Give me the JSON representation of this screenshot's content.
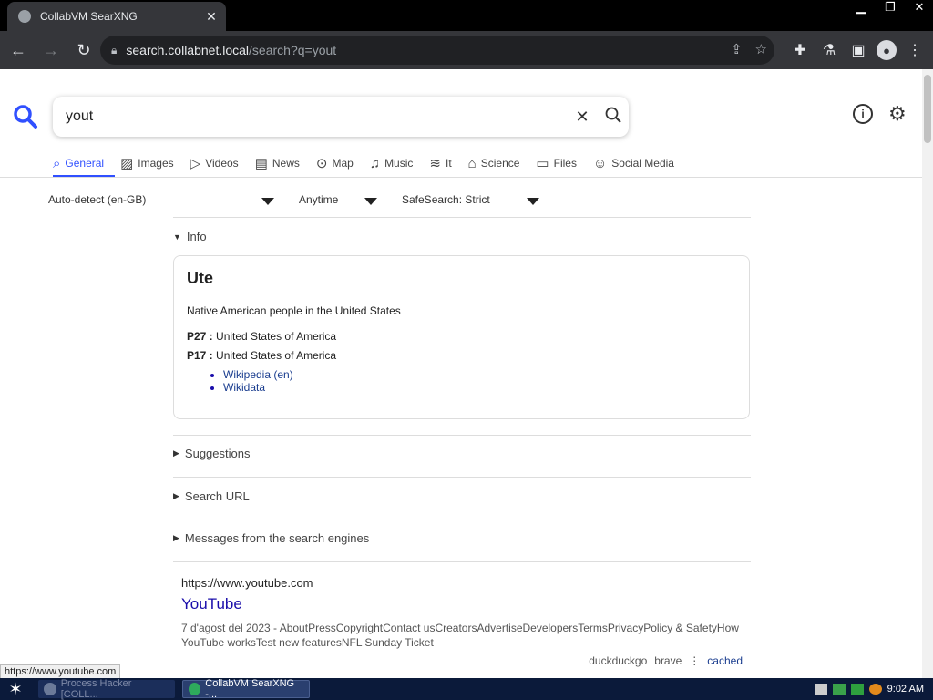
{
  "browser": {
    "tab_title": "CollabVM SearXNG",
    "tab_close": "✕",
    "url_host": "search.collabnet.local",
    "url_path": "/search?q=yout"
  },
  "search": {
    "query": "yout",
    "categories": [
      {
        "label": "General",
        "icon": "search-icon"
      },
      {
        "label": "Images",
        "icon": "image-icon"
      },
      {
        "label": "Videos",
        "icon": "play-icon"
      },
      {
        "label": "News",
        "icon": "newspaper-icon"
      },
      {
        "label": "Map",
        "icon": "map-pin-icon"
      },
      {
        "label": "Music",
        "icon": "music-icon"
      },
      {
        "label": "It",
        "icon": "layers-icon"
      },
      {
        "label": "Science",
        "icon": "graduation-icon"
      },
      {
        "label": "Files",
        "icon": "archive-icon"
      },
      {
        "label": "Social Media",
        "icon": "people-icon"
      }
    ],
    "filters": {
      "language": "Auto-detect (en-GB)",
      "time": "Anytime",
      "safesearch": "SafeSearch: Strict"
    }
  },
  "sections": {
    "info": "Info",
    "suggestions": "Suggestions",
    "search_url": "Search URL",
    "messages": "Messages from the search engines"
  },
  "infobox": {
    "title": "Ute",
    "description": "Native American people in the United States",
    "props": [
      {
        "key": "P27 :",
        "value": "United States of America"
      },
      {
        "key": "P17 :",
        "value": "United States of America"
      }
    ],
    "links": [
      "Wikipedia (en)",
      "Wikidata"
    ]
  },
  "result": {
    "url": "https://www.youtube.com",
    "title": "YouTube",
    "snippet": "7 d'agost del 2023 - AboutPressCopyrightContact usCreatorsAdvertiseDevelopersTermsPrivacyPolicy & SafetyHow YouTube worksTest new featuresNFL Sunday Ticket",
    "engines": [
      "duckduckgo",
      "brave"
    ],
    "cached": "cached"
  },
  "status_bar_url": "https://www.youtube.com",
  "taskbar": {
    "tasks": [
      {
        "label": "Process Hacker [COLL..."
      },
      {
        "label": "CollabVM SearXNG -..."
      }
    ],
    "clock": "9:02 AM"
  },
  "colors": {
    "accent": "#3050ff",
    "link": "#1a0dab",
    "chrome_dark": "#35363a",
    "taskbar": "#0b1a3a"
  }
}
